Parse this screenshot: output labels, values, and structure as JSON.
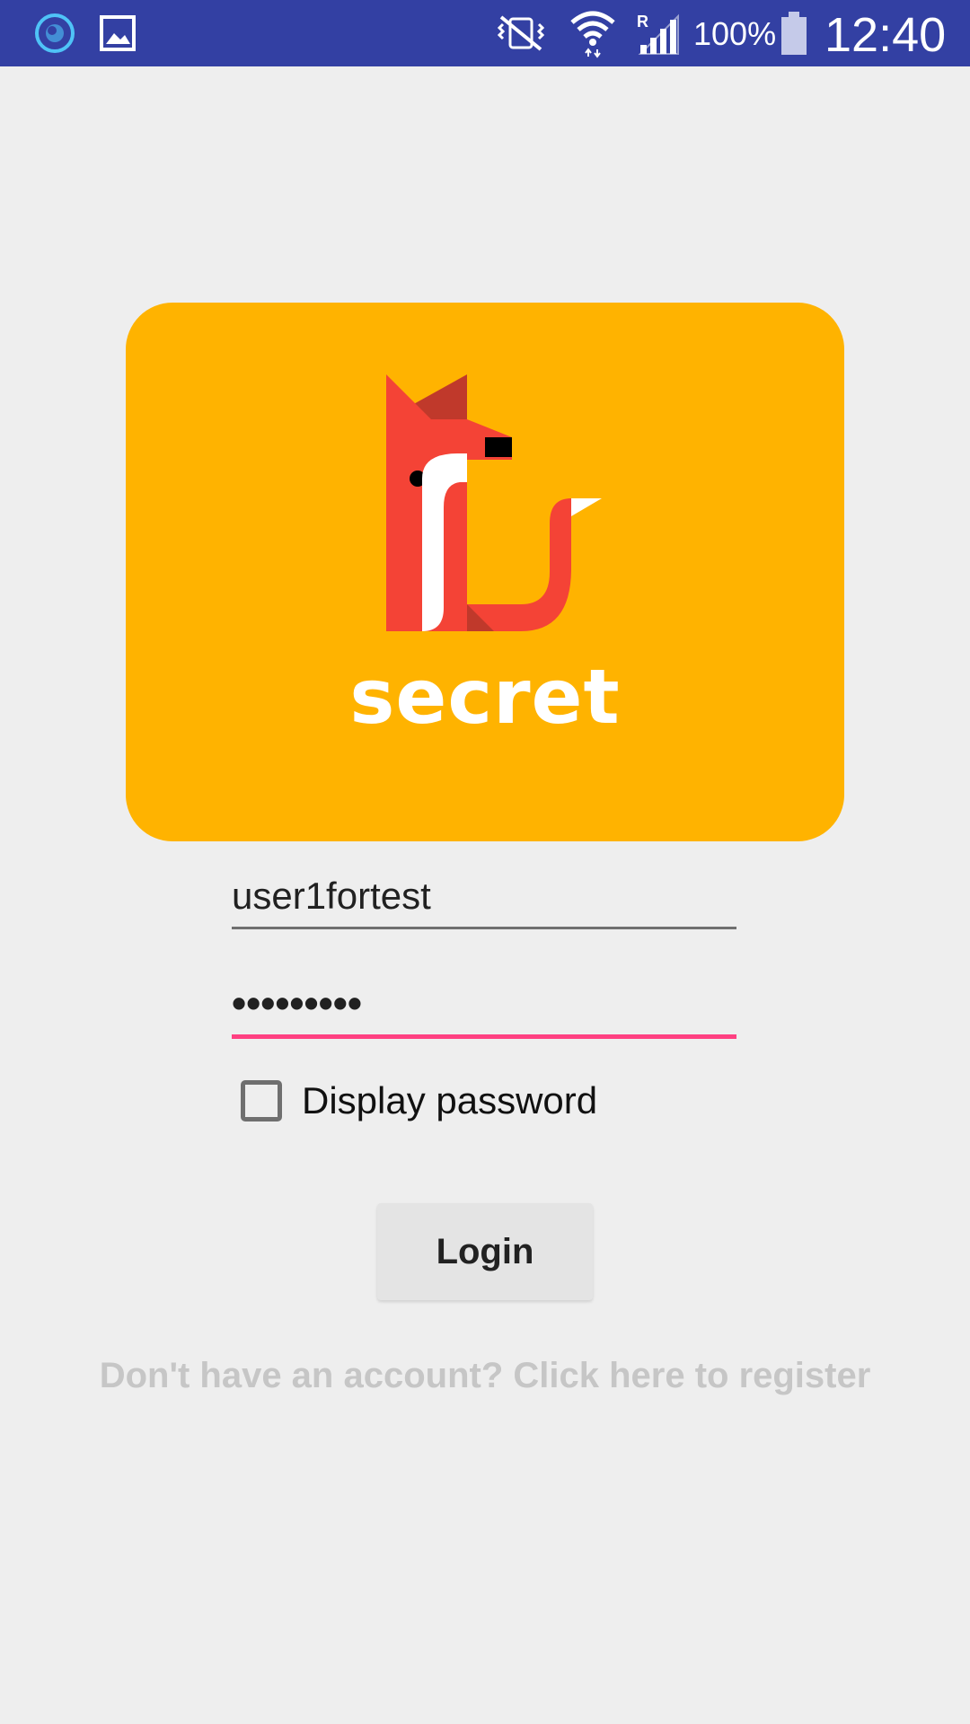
{
  "status_bar": {
    "battery_percent": "100%",
    "time": "12:40",
    "icons": [
      "circular-app-icon",
      "image-icon",
      "vibrate-mute-icon",
      "wifi-icon",
      "signal-roaming-icon",
      "battery-icon"
    ]
  },
  "logo": {
    "text": "secret",
    "card_color": "#ffb300",
    "fox_color": "#f44336"
  },
  "form": {
    "username_value": "user1fortest",
    "password_value": "•••••••••",
    "show_password_label": "Display password",
    "show_password_checked": false,
    "login_label": "Login",
    "register_link": "Don't have an account? Click here to register",
    "accent_color": "#ff4081"
  }
}
